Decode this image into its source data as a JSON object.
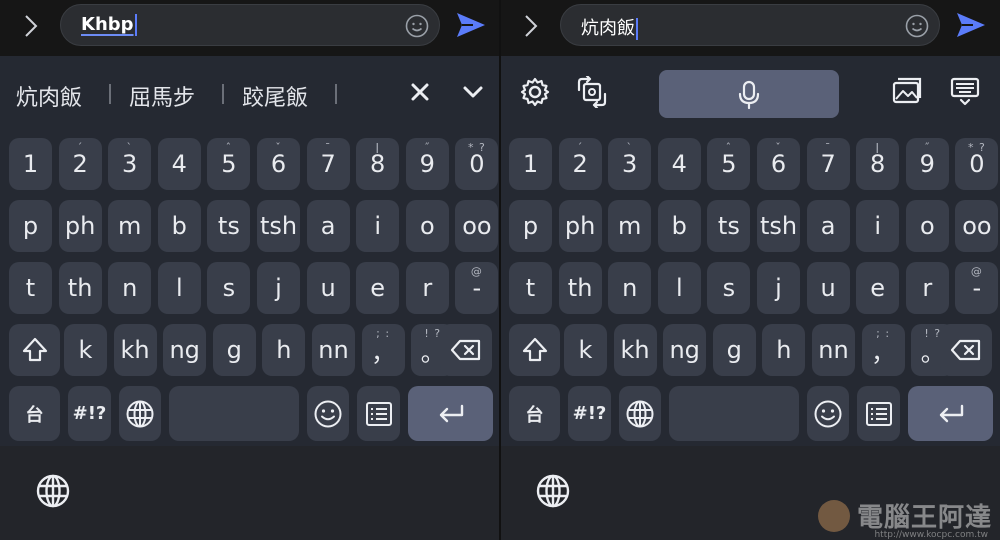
{
  "colors": {
    "accent": "#5b7cfa",
    "key_bg": "#393e4a",
    "keyboard_bg": "#252932",
    "enter_bg": "#5a6178"
  },
  "left": {
    "input": {
      "value": "Khbp"
    },
    "candidates": [
      "炕肉飯",
      "屈馬步",
      "跤尾飯"
    ],
    "keyboard": {
      "row1": [
        {
          "l": "1",
          "s": ""
        },
        {
          "l": "2",
          "s": "ˊ"
        },
        {
          "l": "3",
          "s": "ˋ"
        },
        {
          "l": "4",
          "s": ""
        },
        {
          "l": "5",
          "s": "ˆ"
        },
        {
          "l": "6",
          "s": "ˇ"
        },
        {
          "l": "7",
          "s": "¯"
        },
        {
          "l": "8",
          "s": "ǀ"
        },
        {
          "l": "9",
          "s": "˝"
        },
        {
          "l": "0",
          "s": "* ?"
        }
      ],
      "row2": [
        "p",
        "ph",
        "m",
        "b",
        "ts",
        "tsh",
        "a",
        "i",
        "o",
        "oo"
      ],
      "row3": [
        {
          "l": "t",
          "s": ""
        },
        {
          "l": "th",
          "s": ""
        },
        {
          "l": "n",
          "s": ""
        },
        {
          "l": "l",
          "s": ""
        },
        {
          "l": "s",
          "s": ""
        },
        {
          "l": "j",
          "s": ""
        },
        {
          "l": "u",
          "s": ""
        },
        {
          "l": "e",
          "s": ""
        },
        {
          "l": "r",
          "s": ""
        },
        {
          "l": "-",
          "s": "@"
        }
      ],
      "row4": [
        {
          "l": "k",
          "s": ""
        },
        {
          "l": "kh",
          "s": ""
        },
        {
          "l": "ng",
          "s": ""
        },
        {
          "l": "g",
          "s": ""
        },
        {
          "l": "h",
          "s": ""
        },
        {
          "l": "nn",
          "s": ""
        },
        {
          "l": "，",
          "s": "; :"
        },
        {
          "l": "。",
          "s": "! ?"
        }
      ],
      "lang_key": "台",
      "symbols_key": "#!?"
    }
  },
  "right": {
    "input": {
      "value": "炕肉飯"
    },
    "keyboard": {
      "row1": [
        {
          "l": "1",
          "s": ""
        },
        {
          "l": "2",
          "s": "ˊ"
        },
        {
          "l": "3",
          "s": "ˋ"
        },
        {
          "l": "4",
          "s": ""
        },
        {
          "l": "5",
          "s": "ˆ"
        },
        {
          "l": "6",
          "s": "ˇ"
        },
        {
          "l": "7",
          "s": "¯"
        },
        {
          "l": "8",
          "s": "ǀ"
        },
        {
          "l": "9",
          "s": "˝"
        },
        {
          "l": "0",
          "s": "* ?"
        }
      ],
      "row2": [
        "p",
        "ph",
        "m",
        "b",
        "ts",
        "tsh",
        "a",
        "i",
        "o",
        "oo"
      ],
      "row3": [
        {
          "l": "t",
          "s": ""
        },
        {
          "l": "th",
          "s": ""
        },
        {
          "l": "n",
          "s": ""
        },
        {
          "l": "l",
          "s": ""
        },
        {
          "l": "s",
          "s": ""
        },
        {
          "l": "j",
          "s": ""
        },
        {
          "l": "u",
          "s": ""
        },
        {
          "l": "e",
          "s": ""
        },
        {
          "l": "r",
          "s": ""
        },
        {
          "l": "-",
          "s": "@"
        }
      ],
      "row4": [
        {
          "l": "k",
          "s": ""
        },
        {
          "l": "kh",
          "s": ""
        },
        {
          "l": "ng",
          "s": ""
        },
        {
          "l": "g",
          "s": ""
        },
        {
          "l": "h",
          "s": ""
        },
        {
          "l": "nn",
          "s": ""
        },
        {
          "l": "，",
          "s": "; :"
        },
        {
          "l": "。",
          "s": "! ?"
        }
      ],
      "lang_key": "台",
      "symbols_key": "#!?"
    }
  },
  "watermark": {
    "text": "電腦王阿達",
    "url": "http://www.kocpc.com.tw"
  }
}
